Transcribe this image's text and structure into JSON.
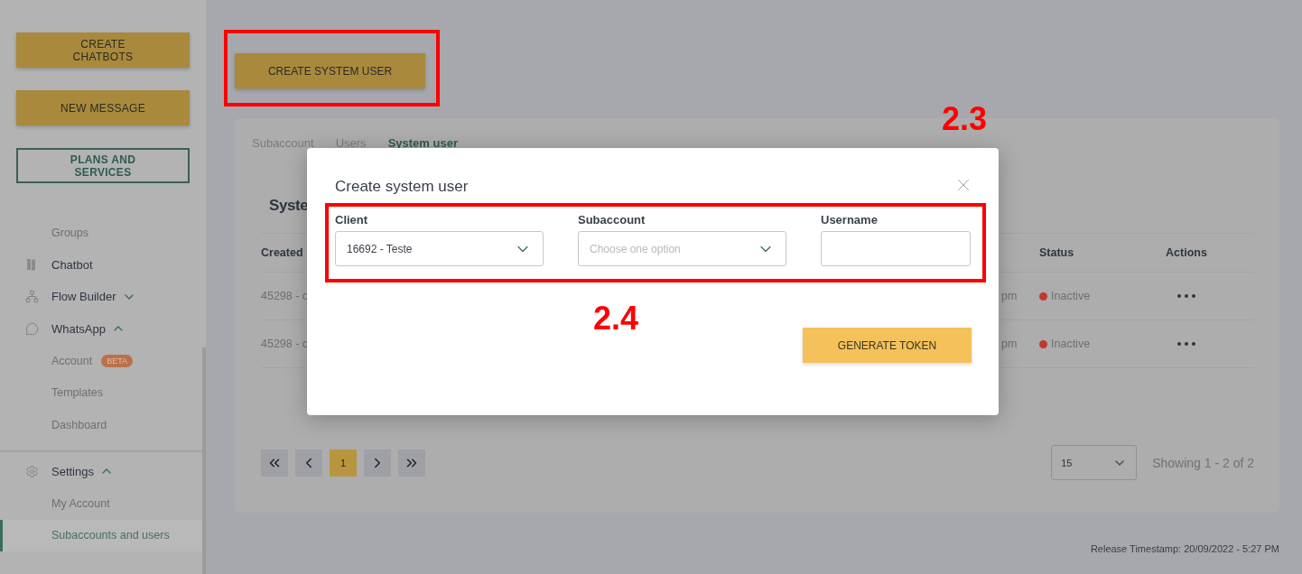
{
  "sidebar": {
    "buttons": [
      {
        "label": "CREATE\nCHATBOTS",
        "kind": "filled"
      },
      {
        "label": "NEW MESSAGE",
        "kind": "filled"
      },
      {
        "label": "PLANS AND\nSERVICES",
        "kind": "outlined"
      }
    ],
    "nav": [
      {
        "label": "Groups",
        "kind": "link",
        "selected": false
      },
      {
        "label": "Chatbot",
        "kind": "section"
      },
      {
        "label": "Flow Builder",
        "kind": "section",
        "expanded": false
      },
      {
        "label": "WhatsApp",
        "kind": "section",
        "expanded": true,
        "children": [
          {
            "label": "Account",
            "badge": "BETA",
            "selected": false
          },
          {
            "label": "Templates",
            "selected": false
          },
          {
            "label": "Dashboard",
            "selected": false
          }
        ]
      },
      {
        "label": "Settings",
        "kind": "section",
        "expanded": true,
        "separated": true,
        "children": [
          {
            "label": "My Account",
            "selected": false
          },
          {
            "label": "Subaccounts and users",
            "selected": true
          }
        ]
      }
    ]
  },
  "main": {
    "create_button": "CREATE SYSTEM USER",
    "card": {
      "tabs": [
        {
          "label": "Subaccount",
          "selected": false
        },
        {
          "label": "Users",
          "selected": false
        },
        {
          "label": "System user",
          "selected": true
        }
      ],
      "title": "Syste",
      "table": {
        "columns": [
          "Created",
          "",
          "Status",
          "Actions"
        ],
        "rows": [
          {
            "created": "45298 - c",
            "time": "pm",
            "status": "Inactive",
            "color": "#c0392b"
          },
          {
            "created": "45298 - c",
            "time": "pm",
            "status": "Inactive",
            "color": "#c0392b"
          }
        ]
      },
      "pagination": {
        "pages": [
          {
            "label": "1",
            "selected": true
          }
        ],
        "per_page": "15",
        "showing": "Showing 1 - 2 of 2"
      }
    },
    "footer": "Release Timestamp: 20/09/2022 - 5:27 PM"
  },
  "modal": {
    "title": "Create system user",
    "fields": [
      {
        "label": "Client",
        "kind": "select",
        "value": "16692 - Teste"
      },
      {
        "label": "Subaccount",
        "kind": "select",
        "placeholder": "Choose one option"
      },
      {
        "label": "Username",
        "kind": "text"
      }
    ],
    "button": "GENERATE TOKEN"
  },
  "annotations": [
    {
      "label": "2.3"
    },
    {
      "label": "2.4"
    }
  ]
}
